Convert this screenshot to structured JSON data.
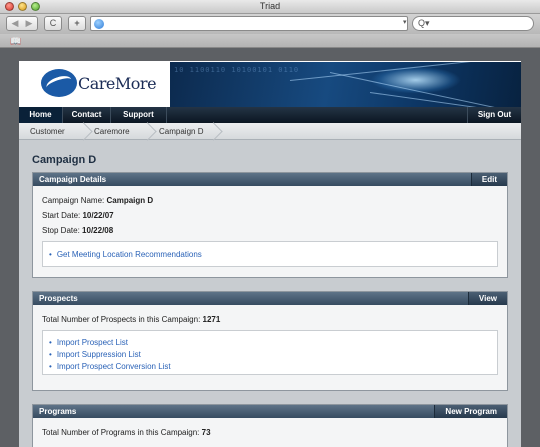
{
  "window": {
    "title": "Triad"
  },
  "browser": {
    "back_label": "◀",
    "forward_label": "▶",
    "reload_label": "C",
    "newtab_label": "+",
    "url_value": "",
    "search_placeholder": "Q▾",
    "bookmarks_icon": "📖"
  },
  "site": {
    "logo_text": "CareMore",
    "banner_digits": "10 1100110 10100101 0110",
    "nav": {
      "home": "Home",
      "contact": "Contact",
      "support": "Support",
      "signout": "Sign Out"
    },
    "breadcrumb": [
      "Customer",
      "Caremore",
      "Campaign D"
    ],
    "page_title": "Campaign D",
    "details": {
      "header": "Campaign Details",
      "edit_label": "Edit",
      "name_label": "Campaign Name:",
      "name_value": "Campaign D",
      "start_label": "Start Date:",
      "start_value": "10/22/07",
      "stop_label": "Stop Date:",
      "stop_value": "10/22/08",
      "links": [
        "Get Meeting Location Recommendations"
      ]
    },
    "prospects": {
      "header": "Prospects",
      "view_label": "View",
      "total_label": "Total Number of Prospects in this Campaign:",
      "total_value": "1271",
      "links": [
        "Import Prospect List",
        "Import Suppression List",
        "Import Prospect Conversion List"
      ]
    },
    "programs": {
      "header": "Programs",
      "new_label": "New Program",
      "total_label": "Total Number of Programs in this Campaign:",
      "total_value": "73"
    }
  }
}
